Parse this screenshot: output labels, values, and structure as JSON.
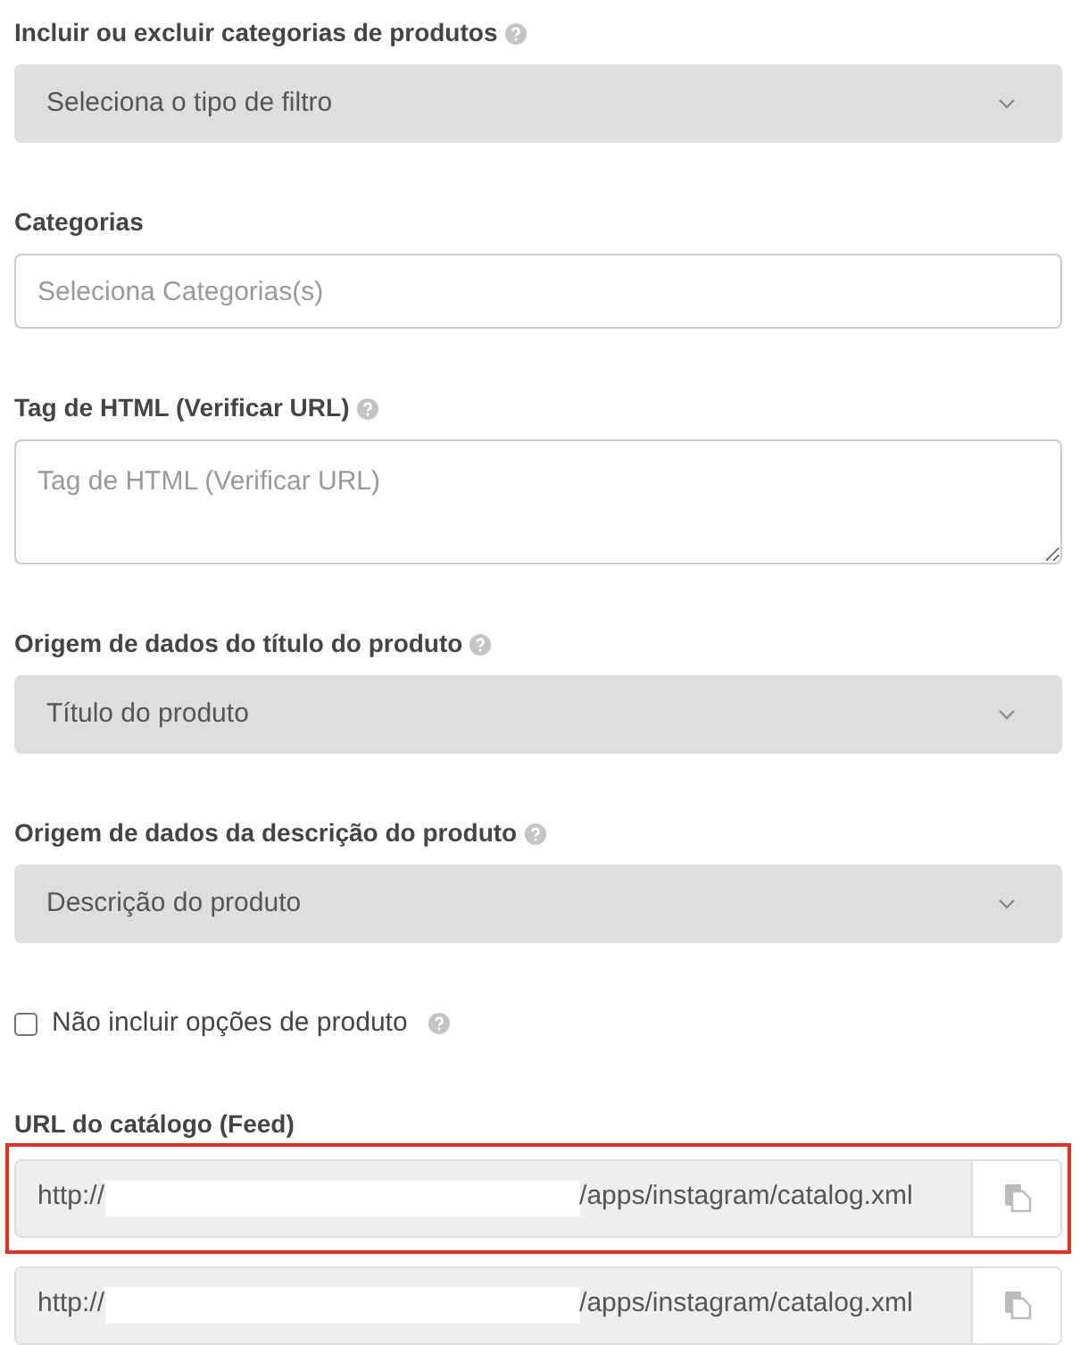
{
  "fields": [
    {
      "kind": "select",
      "label": "Incluir ou excluir categorias de produtos",
      "help": true,
      "value": "Seleciona o tipo de filtro"
    },
    {
      "kind": "input",
      "label": "Categorias",
      "help": false,
      "placeholder": "Seleciona Categorias(s)"
    },
    {
      "kind": "textarea",
      "label": "Tag de HTML (Verificar URL)",
      "help": true,
      "placeholder": "Tag de HTML (Verificar URL)"
    },
    {
      "kind": "select",
      "label": "Origem de dados do título do produto",
      "help": true,
      "value": "Título do produto"
    },
    {
      "kind": "select",
      "label": "Origem de dados da descrição do produto",
      "help": true,
      "value": "Descrição do produto"
    }
  ],
  "checkbox": {
    "label": "Não incluir opções de produto",
    "checked": false,
    "help": true
  },
  "catalog": {
    "label": "URL do catálogo (Feed)",
    "urls": [
      {
        "prefix": "http://",
        "suffix": "/apps/instagram/catalog.xml",
        "highlighted": true
      },
      {
        "prefix": "http://",
        "suffix": "/apps/instagram/catalog.xml",
        "highlighted": false
      }
    ]
  }
}
